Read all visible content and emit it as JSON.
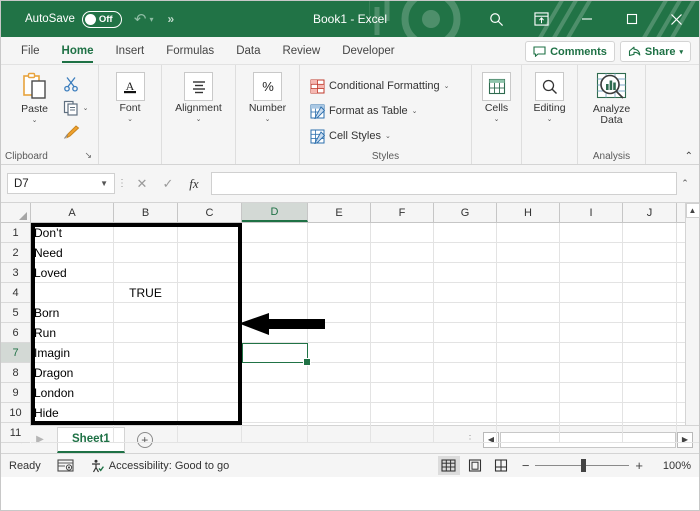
{
  "titlebar": {
    "autosave_label": "AutoSave",
    "autosave_state": "Off",
    "undo_icon": "undo-icon",
    "more_commands": "»",
    "document_title": "Book1  -  Excel",
    "search_icon": "search-icon",
    "ribbon_display_icon": "ribbon-display-options-icon",
    "minimize_icon": "minimize-icon",
    "maximize_icon": "maximize-icon",
    "close_icon": "close-icon",
    "bg_color": "#217346"
  },
  "tabs": {
    "items": [
      {
        "label": "File",
        "active": false
      },
      {
        "label": "Home",
        "active": true
      },
      {
        "label": "Insert",
        "active": false
      },
      {
        "label": "Formulas",
        "active": false
      },
      {
        "label": "Data",
        "active": false
      },
      {
        "label": "Review",
        "active": false
      },
      {
        "label": "Developer",
        "active": false
      }
    ],
    "comments_label": "Comments",
    "share_label": "Share",
    "active_color": "#1e7145"
  },
  "ribbon": {
    "clipboard": {
      "group_label": "Clipboard",
      "paste_label": "Paste",
      "paste_caret": "⌄",
      "cut_icon": "scissors-icon",
      "copy_icon": "copy-icon",
      "copy_caret": "⌄",
      "format_painter_icon": "format-painter-icon",
      "dialog_launcher": "↘"
    },
    "font": {
      "label": "Font",
      "caret": "⌄",
      "icon": "font-A-icon"
    },
    "alignment": {
      "label": "Alignment",
      "caret": "⌄",
      "icon": "alignment-lines-icon"
    },
    "number": {
      "label": "Number",
      "caret": "⌄",
      "icon": "percent-icon"
    },
    "styles": {
      "group_label": "Styles",
      "items": [
        {
          "label": "Conditional Formatting",
          "caret": "⌄",
          "icon": "conditional-formatting-icon"
        },
        {
          "label": "Format as Table",
          "caret": "⌄",
          "icon": "format-as-table-icon"
        },
        {
          "label": "Cell Styles",
          "caret": "⌄",
          "icon": "cell-styles-icon"
        }
      ]
    },
    "cells": {
      "label": "Cells",
      "caret": "⌄",
      "icon": "cells-table-icon"
    },
    "editing": {
      "label": "Editing",
      "caret": "⌄",
      "icon": "magnifier-icon"
    },
    "analysis": {
      "group_label": "Analysis",
      "label_line1": "Analyze",
      "label_line2": "Data",
      "icon": "analyze-data-icon"
    },
    "collapse_caret": "⌃"
  },
  "formulabar": {
    "namebox_value": "D7",
    "namebox_caret": "▼",
    "cancel_icon": "✕",
    "enter_icon": "✓",
    "function_icon": "fx",
    "formula_value": "",
    "expand_caret": "⌃"
  },
  "grid": {
    "columns": [
      "A",
      "B",
      "C",
      "D",
      "E",
      "F",
      "G",
      "H",
      "I",
      "J"
    ],
    "selected_column": "D",
    "rows": [
      "1",
      "2",
      "3",
      "4",
      "5",
      "6",
      "7",
      "8",
      "9",
      "10",
      "11"
    ],
    "selected_row": "7",
    "cell_values": [
      {
        "row": "1",
        "col": "A",
        "value": "Don’t",
        "align": "left"
      },
      {
        "row": "2",
        "col": "A",
        "value": "Need",
        "align": "left"
      },
      {
        "row": "3",
        "col": "A",
        "value": "Loved",
        "align": "left"
      },
      {
        "row": "4",
        "col": "B",
        "value": "TRUE",
        "align": "center"
      },
      {
        "row": "5",
        "col": "A",
        "value": "Born",
        "align": "left"
      },
      {
        "row": "6",
        "col": "A",
        "value": "Run",
        "align": "left"
      },
      {
        "row": "7",
        "col": "A",
        "value": "Imagin",
        "align": "left"
      },
      {
        "row": "8",
        "col": "A",
        "value": "Dragon",
        "align": "left"
      },
      {
        "row": "9",
        "col": "A",
        "value": "London",
        "align": "left"
      },
      {
        "row": "10",
        "col": "A",
        "value": "Hide",
        "align": "left"
      }
    ],
    "column_a": [
      "Don’t",
      "Need",
      "Loved",
      "",
      "Born",
      "Run",
      "Imagin",
      "Dragon",
      "London",
      "Hide",
      ""
    ],
    "column_b": [
      "",
      "",
      "",
      "TRUE",
      "",
      "",
      "",
      "",
      "",
      "",
      ""
    ],
    "active_cell": "D7",
    "selection_color": "#217346",
    "highlight_border_color": "#000000",
    "annotation_arrow": "left-pointing-arrow",
    "scroll_up_icon": "▲"
  },
  "sheetbar": {
    "prev_icon": "◀",
    "next_icon": "▶",
    "sheet_name": "Sheet1",
    "add_sheet_icon": "+",
    "hscroll_left_icon": "◀",
    "hscroll_right_icon": "▶"
  },
  "statusbar": {
    "mode": "Ready",
    "macro_icon": "record-macro-icon",
    "accessibility_icon": "accessibility-icon",
    "accessibility_text": "Accessibility: Good to go",
    "view_normal_icon": "normal-view-icon",
    "view_pagelayout_icon": "page-layout-view-icon",
    "view_pagebreak_icon": "page-break-view-icon",
    "zoom_out_icon": "−",
    "zoom_in_icon": "+",
    "zoom_level": "100%"
  }
}
